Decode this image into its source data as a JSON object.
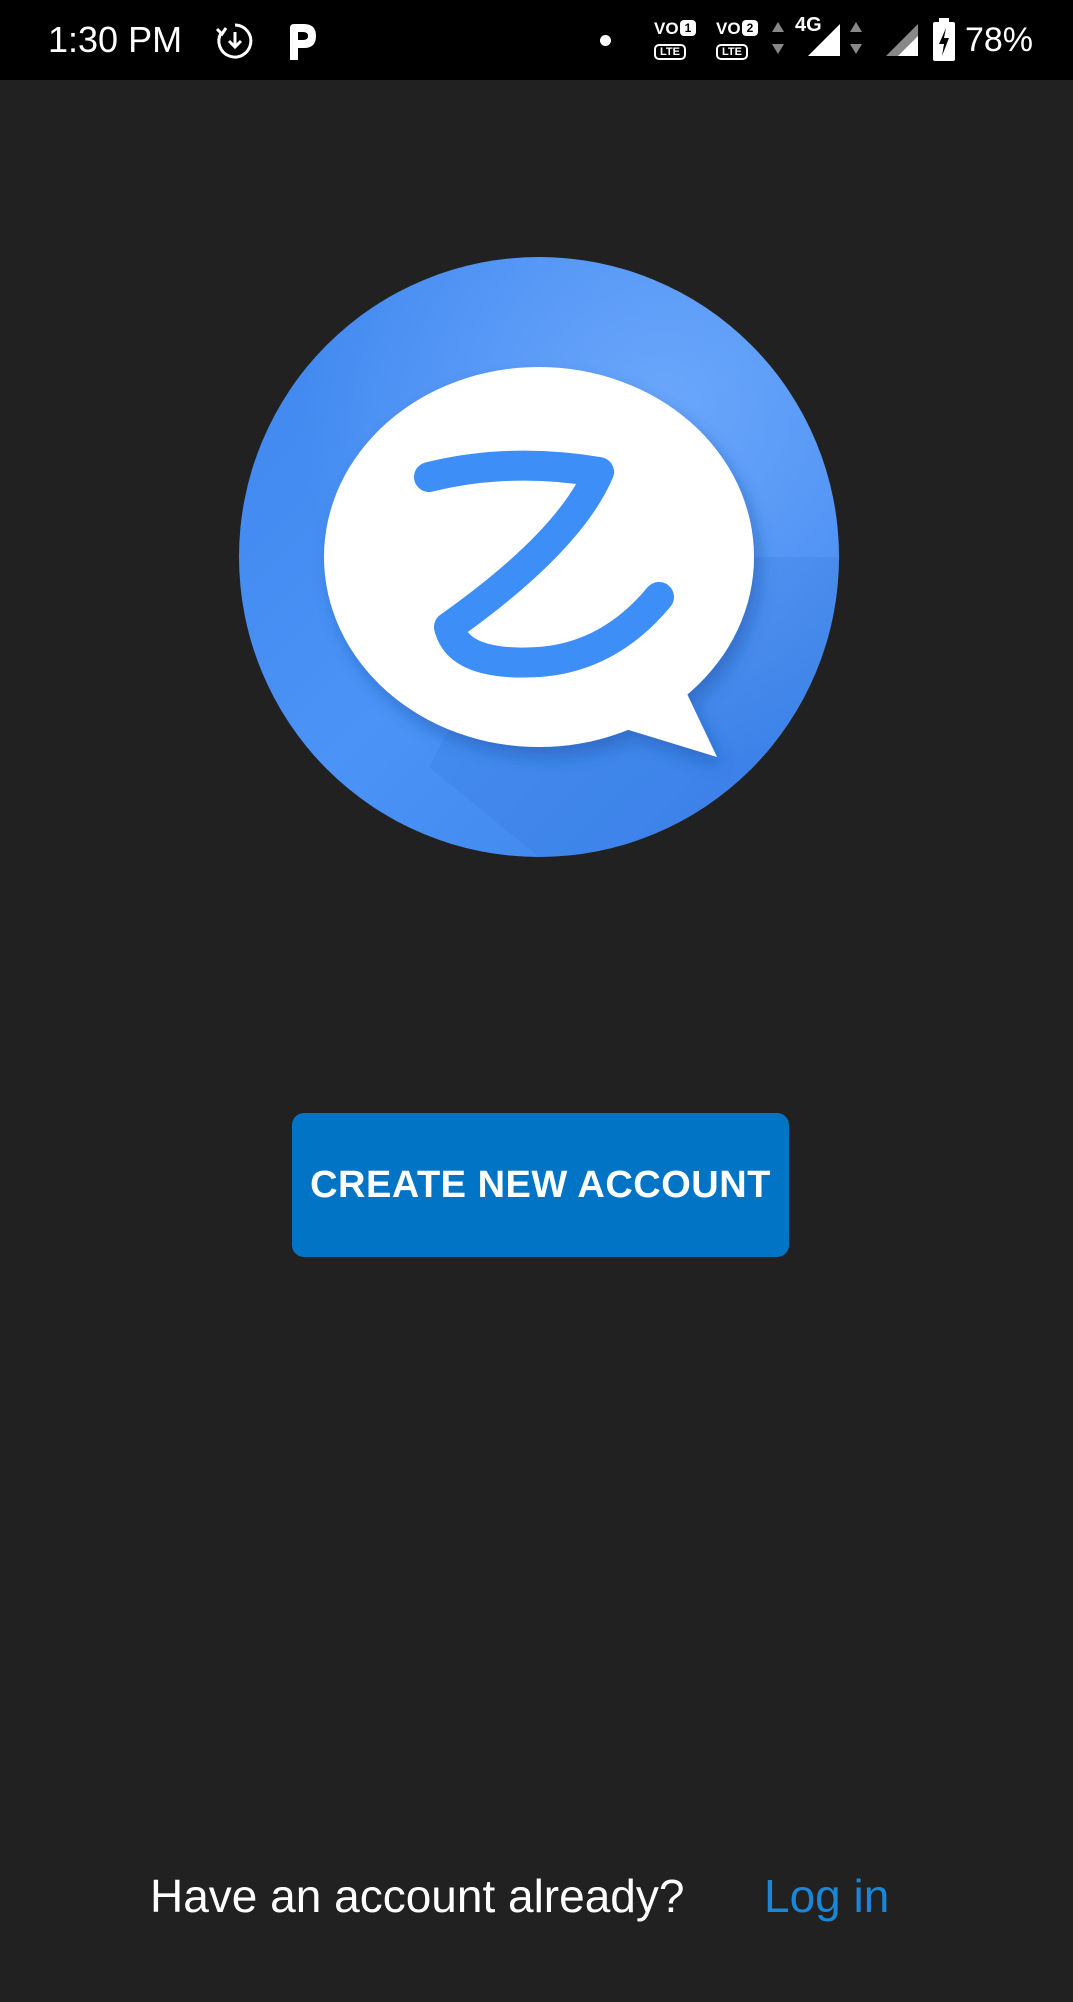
{
  "status_bar": {
    "time": "1:30 PM",
    "icons": [
      "sync-download-icon",
      "p-app-icon",
      "notification-dot-icon",
      "volte-1-icon",
      "volte-2-icon",
      "4g-signal-icon",
      "signal-icon",
      "battery-charging-icon"
    ],
    "volte_1": {
      "vo": "VO",
      "sim": "1",
      "lte": "LTE"
    },
    "volte_2": {
      "vo": "VO",
      "sim": "2",
      "lte": "LTE"
    },
    "network": "4G",
    "battery": "78%"
  },
  "logo": {
    "icon": "chat-bubble-z-logo-icon",
    "circle_color": "#4a90f5",
    "bubble_color": "#ffffff",
    "letter_color": "#3d8ef7"
  },
  "main": {
    "create_button_label": "CREATE NEW ACCOUNT",
    "button_color": "#0274c5"
  },
  "footer": {
    "prompt": "Have an account already?",
    "login_label": "Log in",
    "link_color": "#1a86d6"
  }
}
